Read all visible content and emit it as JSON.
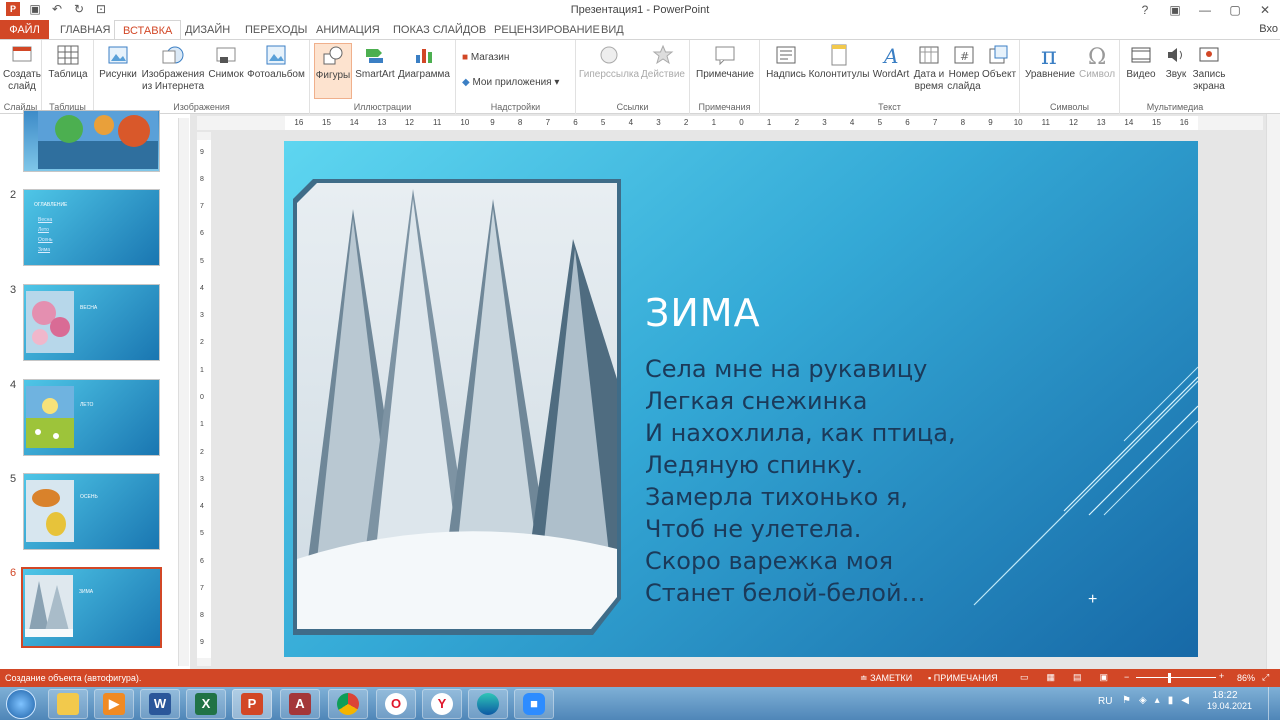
{
  "window": {
    "title": "Презентация1 - PowerPoint",
    "controls": [
      "?",
      "▣",
      "—",
      "▢",
      "✕"
    ]
  },
  "quick_access": {
    "icons": [
      "powerpoint-icon",
      "save-icon",
      "undo-icon",
      "redo-icon",
      "present-icon"
    ]
  },
  "tabs": {
    "file": "ФАЙЛ",
    "items": [
      "ГЛАВНАЯ",
      "ВСТАВКА",
      "ДИЗАЙН",
      "ПЕРЕХОДЫ",
      "АНИМАЦИЯ",
      "ПОКАЗ СЛАЙДОВ",
      "РЕЦЕНЗИРОВАНИЕ",
      "ВИД"
    ],
    "active": "ВСТАВКА",
    "signin": "Вхо"
  },
  "ribbon": {
    "groups": {
      "slides": "Слайды",
      "tables": "Таблицы",
      "images": "Изображения",
      "illustrations": "Иллюстрации",
      "addins": "Надстройки",
      "links": "Ссылки",
      "comments": "Примечания",
      "text": "Текст",
      "symbols": "Символы",
      "media": "Мультимедиа"
    },
    "buttons": {
      "new_slide": "Создать слайд",
      "table": "Таблица",
      "pictures": "Рисунки",
      "online_pictures_1": "Изображения",
      "online_pictures_2": "из Интернета",
      "screenshot": "Снимок",
      "photo_album": "Фотоальбом",
      "shapes": "Фигуры",
      "smartart": "SmartArt",
      "chart": "Диаграмма",
      "store": "Магазин",
      "my_apps": "Мои приложения",
      "hyperlink": "Гиперссылка",
      "action": "Действие",
      "comment": "Примечание",
      "textbox": "Надпись",
      "header_footer": "Колонтитулы",
      "wordart": "WordArt",
      "datetime_1": "Дата и",
      "datetime_2": "время",
      "slide_number_1": "Номер",
      "slide_number_2": "слайда",
      "object": "Объект",
      "equation": "Уравнение",
      "symbol": "Символ",
      "video": "Видео",
      "audio": "Звук",
      "screen_recording_1": "Запись",
      "screen_recording_2": "экрана"
    }
  },
  "thumbnails": [
    {
      "number": "",
      "title": ""
    },
    {
      "number": "2",
      "title": "ОГЛАВЛЕНИЕ",
      "links": [
        "Весна",
        "Лето",
        "Осень",
        "Зима"
      ]
    },
    {
      "number": "3",
      "title": "ВЕСНА"
    },
    {
      "number": "4",
      "title": "ЛЕТО"
    },
    {
      "number": "5",
      "title": "ОСЕНЬ"
    },
    {
      "number": "6",
      "title": "ЗИМА"
    }
  ],
  "rulers": {
    "horizontal": [
      "16",
      "15",
      "14",
      "13",
      "12",
      "11",
      "10",
      "9",
      "8",
      "7",
      "6",
      "5",
      "4",
      "3",
      "2",
      "1",
      "0",
      "1",
      "2",
      "3",
      "4",
      "5",
      "6",
      "7",
      "8",
      "9",
      "10",
      "11",
      "12",
      "13",
      "14",
      "15",
      "16"
    ],
    "vertical": [
      "9",
      "8",
      "7",
      "6",
      "5",
      "4",
      "3",
      "2",
      "1",
      "0",
      "1",
      "2",
      "3",
      "4",
      "5",
      "6",
      "7",
      "8",
      "9"
    ]
  },
  "slide": {
    "title": "ЗИМА",
    "lines": [
      "Села мне на рукавицу",
      "Легкая снежинка",
      "И нахохлила, как птица,",
      "Ледяную спинку.",
      "Замерла тихонько я,",
      "Чтоб не улетела.",
      "Скоро варежка моя",
      "Станет белой-белой…"
    ]
  },
  "status": {
    "message": "Создание объекта (автофигура).",
    "notes": "ЗАМЕТКИ",
    "comments": "ПРИМЕЧАНИЯ",
    "zoom": "86%"
  },
  "taskbar": {
    "apps": [
      "start-button",
      "explorer-icon",
      "media-player-icon",
      "word-icon",
      "excel-icon",
      "powerpoint-icon",
      "access-icon",
      "chrome-icon",
      "opera-icon",
      "yandex-icon",
      "edge-icon",
      "zoom-icon"
    ],
    "lang": "RU",
    "time": "18:22",
    "date": "19.04.2021"
  },
  "colors": {
    "accent": "#d24726",
    "slide_text": "#1b3a5a",
    "slide_title": "#ffffff"
  }
}
